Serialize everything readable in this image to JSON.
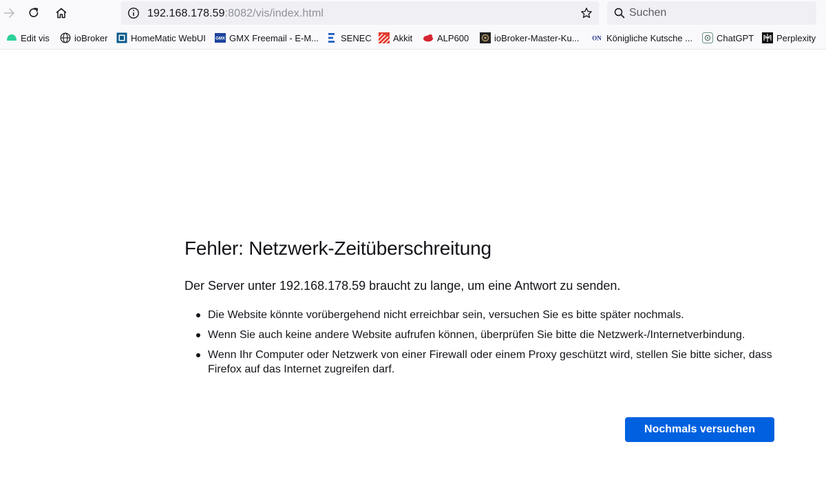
{
  "toolbar": {
    "back_icon": "arrow-left-icon",
    "reload_icon": "reload-icon",
    "home_icon": "home-icon",
    "url_host": "192.168.178.59",
    "url_rest": ":8082/vis/index.html",
    "search_placeholder": "Suchen"
  },
  "bookmarks": [
    {
      "label": "Edit vis",
      "icon": "vis-icon"
    },
    {
      "label": "ioBroker",
      "icon": "globe-icon"
    },
    {
      "label": "HomeMatic WebUI",
      "icon": "homematic-icon"
    },
    {
      "label": "GMX Freemail - E-M...",
      "icon": "gmx-icon"
    },
    {
      "label": "SENEC",
      "icon": "senec-icon"
    },
    {
      "label": "Akkit",
      "icon": "akkit-icon"
    },
    {
      "label": "ALP600",
      "icon": "alp600-icon"
    },
    {
      "label": "ioBroker-Master-Ku...",
      "icon": "iobroker-master-icon"
    },
    {
      "label": "Königliche Kutsche ...",
      "icon": "on-icon"
    },
    {
      "label": "ChatGPT",
      "icon": "chatgpt-icon"
    },
    {
      "label": "Perplexity",
      "icon": "perplexity-icon"
    }
  ],
  "error": {
    "title": "Fehler: Netzwerk-Zeitüberschreitung",
    "lead": "Der Server unter 192.168.178.59 braucht zu lange, um eine Antwort zu senden.",
    "reasons": [
      "Die Website könnte vorübergehend nicht erreichbar sein, versuchen Sie es bitte später nochmals.",
      "Wenn Sie auch keine andere Website aufrufen können, überprüfen Sie bitte die Netzwerk-/Internetverbindung.",
      "Wenn Ihr Computer oder Netzwerk von einer Firewall oder einem Proxy geschützt wird, stellen Sie bitte sicher, dass Firefox auf das Internet zugreifen darf."
    ],
    "retry_label": "Nochmals versuchen"
  },
  "colors": {
    "accent": "#0061e0",
    "toolbar_bg": "#f9f9fb",
    "field_bg": "#f0f0f4"
  }
}
